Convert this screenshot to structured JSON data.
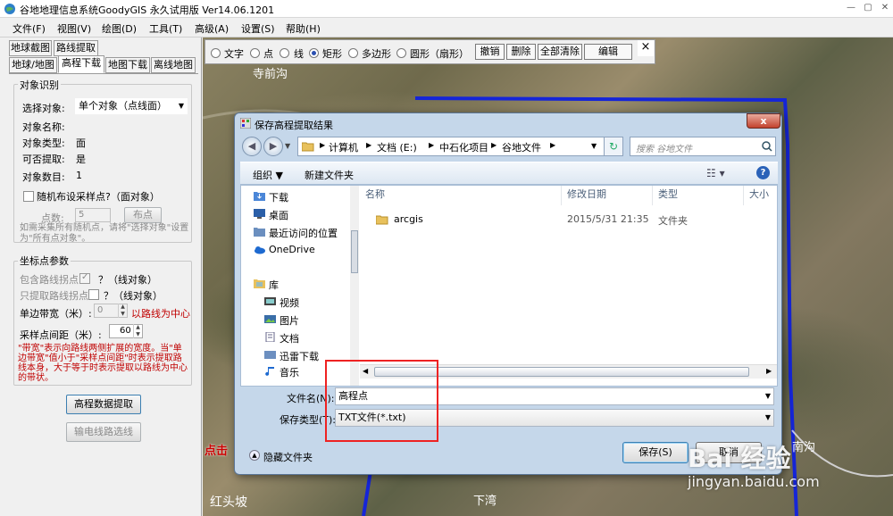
{
  "app": {
    "title": "谷地地理信息系统GoodyGIS 永久试用版 Ver14.06.1201"
  },
  "menu": [
    "文件(F)",
    "视图(V)",
    "绘图(D)",
    "工具(T)",
    "高级(A)",
    "设置(S)",
    "帮助(H)"
  ],
  "left": {
    "tabs_row1": [
      "地球截图",
      "路线提取"
    ],
    "tabs_row2": [
      "地球/地图",
      "高程下载",
      "地图下载",
      "离线地图"
    ],
    "obj_group": "对象识别",
    "select_label": "选择对象:",
    "select_value": "单个对象（点线面）",
    "name_label": "对象名称:",
    "type_label": "对象类型:",
    "type_value": "面",
    "extract_label": "可否提取:",
    "extract_value": "是",
    "count_label": "对象数目:",
    "count_value": "1",
    "random_label": "随机布设采样点?（面对象）",
    "points_label": "点数:",
    "points_value": "5",
    "points_btn": "布点",
    "random_note": "如需采集所有随机点，请将\"选择对象\"设置为\"所有点对象\"。",
    "coord_group": "坐标点参数",
    "include_label": "包含路线拐点",
    "include_suffix": "？（线对象）",
    "only_label": "只提取路线拐点",
    "only_suffix": "？（线对象）",
    "band_label": "单边带宽（米）:",
    "band_value": "0",
    "band_suffix": "以路线为中心",
    "interval_label": "采样点间距（米）:",
    "interval_value": "60",
    "note": "\"带宽\"表示向路线两侧扩展的宽度。当\"单边带宽\"值小于\"采样点间距\"时表示提取路线本身，大于等于时表示提取以路线为中心的带状。",
    "extract_btn": "高程数据提取",
    "power_btn": "输电线路选线"
  },
  "drawbar": {
    "options": [
      "文字",
      "点",
      "线",
      "矩形",
      "多边形",
      "圆形（扇形）"
    ],
    "selected": "矩形",
    "buttons": [
      "撤销",
      "删除",
      "全部清除",
      "编辑"
    ],
    "close": "×"
  },
  "map": {
    "labels": [
      "寺前沟",
      "红头坡",
      "下湾",
      "南沟"
    ],
    "partial": "点击"
  },
  "dialog": {
    "title": "保存高程提取结果",
    "close": "x",
    "breadcrumb": [
      "计算机",
      "文档 (E:)",
      "中石化项目",
      "谷地文件"
    ],
    "search_placeholder": "搜索 谷地文件",
    "organize": "组织 ▼",
    "newfolder": "新建文件夹",
    "nav": [
      "下载",
      "桌面",
      "最近访问的位置",
      "OneDrive",
      "库",
      "视频",
      "图片",
      "文档",
      "迅雷下载",
      "音乐"
    ],
    "columns": [
      "名称",
      "修改日期",
      "类型",
      "大小"
    ],
    "files": [
      {
        "name": "arcgis",
        "date": "2015/5/31 21:35",
        "type": "文件夹"
      }
    ],
    "filename_label": "文件名(N):",
    "filename_value": "高程点",
    "filetype_label": "保存类型(T):",
    "filetype_value": "TXT文件(*.txt)",
    "hide_folders": "隐藏文件夹",
    "save": "保存(S)",
    "cancel": "取消"
  },
  "watermark": {
    "main": "Bai 经验",
    "sub": "jingyan.baidu.com"
  }
}
